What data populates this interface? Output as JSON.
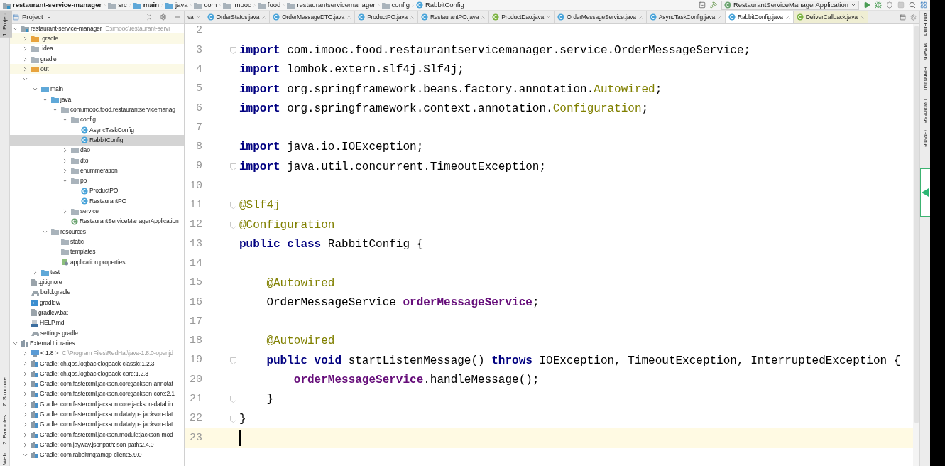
{
  "breadcrumbs": [
    {
      "label": "restaurant-service-manager",
      "kind": "module",
      "bold": true
    },
    {
      "label": "src",
      "kind": "folder",
      "bold": false
    },
    {
      "label": "main",
      "kind": "source",
      "bold": true
    },
    {
      "label": "java",
      "kind": "source",
      "bold": false
    },
    {
      "label": "com",
      "kind": "package",
      "bold": false
    },
    {
      "label": "imooc",
      "kind": "package",
      "bold": false
    },
    {
      "label": "food",
      "kind": "package",
      "bold": false
    },
    {
      "label": "restaurantservicemanager",
      "kind": "package",
      "bold": false
    },
    {
      "label": "config",
      "kind": "package",
      "bold": false
    },
    {
      "label": "RabbitConfig",
      "kind": "class",
      "bold": false
    }
  ],
  "run_configuration": "RestaurantServiceManagerApplication",
  "project_panel": {
    "title": "Project",
    "tree": [
      {
        "label": "restaurant-service-manager",
        "hint": "E:\\imooc\\restaurant-servi",
        "kind": "module",
        "expanded": true,
        "selected": false,
        "children": [
          {
            "label": ".gradle",
            "kind": "excluded",
            "expanded": false,
            "selected": false
          },
          {
            "label": ".idea",
            "kind": "folder",
            "expanded": false,
            "selected": false
          },
          {
            "label": "gradle",
            "kind": "folder",
            "expanded": false,
            "selected": false
          },
          {
            "label": "out",
            "kind": "excluded",
            "expanded": false,
            "selected": false
          },
          {
            "kind": "obscured",
            "expanded": true,
            "selected": false,
            "children": [
              {
                "label": "main",
                "kind": "source",
                "expanded": true,
                "selected": false,
                "children": [
                  {
                    "label": "java",
                    "kind": "source",
                    "expanded": true,
                    "selected": false,
                    "children": [
                      {
                        "label": "com.imooc.food.restaurantservicemanag",
                        "kind": "package",
                        "expanded": true,
                        "selected": false,
                        "children": [
                          {
                            "label": "config",
                            "kind": "package",
                            "expanded": true,
                            "selected": false,
                            "children": [
                              {
                                "label": "AsyncTaskConfig",
                                "kind": "class",
                                "selected": false
                              },
                              {
                                "label": "RabbitConfig",
                                "kind": "class",
                                "selected": true
                              }
                            ]
                          },
                          {
                            "label": "dao",
                            "kind": "package",
                            "expanded": false,
                            "selected": false
                          },
                          {
                            "label": "dto",
                            "kind": "package",
                            "expanded": false,
                            "selected": false
                          },
                          {
                            "label": "enummeration",
                            "kind": "package",
                            "expanded": false,
                            "selected": false
                          },
                          {
                            "label": "po",
                            "kind": "package",
                            "expanded": true,
                            "selected": false,
                            "children": [
                              {
                                "label": "ProductPO",
                                "kind": "class",
                                "selected": false
                              },
                              {
                                "label": "RestaurantPO",
                                "kind": "class",
                                "selected": false
                              }
                            ]
                          },
                          {
                            "label": "service",
                            "kind": "package",
                            "expanded": false,
                            "selected": false
                          },
                          {
                            "label": "RestaurantServiceManagerApplication",
                            "kind": "spring",
                            "selected": false
                          }
                        ]
                      }
                    ]
                  },
                  {
                    "label": "resources",
                    "kind": "resources",
                    "expanded": true,
                    "selected": false,
                    "children": [
                      {
                        "label": "static",
                        "kind": "folder",
                        "selected": false
                      },
                      {
                        "label": "templates",
                        "kind": "folder",
                        "selected": false
                      },
                      {
                        "label": "application.properties",
                        "kind": "properties",
                        "selected": false
                      }
                    ]
                  }
                ]
              },
              {
                "label": "test",
                "kind": "source",
                "expanded": false,
                "selected": false
              }
            ]
          },
          {
            "label": ".gitignore",
            "kind": "file",
            "selected": false
          },
          {
            "label": "build.gradle",
            "kind": "gradle",
            "selected": false
          },
          {
            "label": "gradlew",
            "kind": "script",
            "selected": false
          },
          {
            "label": "gradlew.bat",
            "kind": "file",
            "selected": false
          },
          {
            "label": "HELP.md",
            "kind": "markdown",
            "selected": false
          },
          {
            "label": "settings.gradle",
            "kind": "gradle",
            "selected": false
          }
        ]
      },
      {
        "label": "External Libraries",
        "kind": "libraries",
        "expanded": true,
        "selected": false,
        "children": [
          {
            "label": "< 1.8 >",
            "hint": "C:\\Program Files\\RedHat\\java-1.8.0-openjd",
            "kind": "jdk",
            "expanded": false,
            "selected": false
          },
          {
            "label": "Gradle: ch.qos.logback:logback-classic:1.2.3",
            "kind": "library",
            "expanded": false,
            "selected": false
          },
          {
            "label": "Gradle: ch.qos.logback:logback-core:1.2.3",
            "kind": "library",
            "expanded": false,
            "selected": false
          },
          {
            "label": "Gradle: com.fasterxml.jackson.core:jackson-annotat",
            "kind": "library",
            "expanded": false,
            "selected": false
          },
          {
            "label": "Gradle: com.fasterxml.jackson.core:jackson-core:2.1",
            "kind": "library",
            "expanded": false,
            "selected": false
          },
          {
            "label": "Gradle: com.fasterxml.jackson.core:jackson-databin",
            "kind": "library",
            "expanded": false,
            "selected": false
          },
          {
            "label": "Gradle: com.fasterxml.jackson.datatype:jackson-dat",
            "kind": "library",
            "expanded": false,
            "selected": false
          },
          {
            "label": "Gradle: com.fasterxml.jackson.datatype:jackson-dat",
            "kind": "library",
            "expanded": false,
            "selected": false
          },
          {
            "label": "Gradle: com.fasterxml.jackson.module:jackson-mod",
            "kind": "library",
            "expanded": false,
            "selected": false
          },
          {
            "label": "Gradle: com.jayway.jsonpath:json-path:2.4.0",
            "kind": "library",
            "expanded": false,
            "selected": false
          },
          {
            "label": "Gradle: com.rabbitmq:amqp-client:5.9.0",
            "kind": "library",
            "expanded": true,
            "selected": false
          }
        ]
      }
    ]
  },
  "tabs": [
    {
      "label": "va",
      "library": false,
      "selected": false
    },
    {
      "label": "OrderStatus.java",
      "kind": "class",
      "library": false,
      "selected": false
    },
    {
      "label": "OrderMessageDTO.java",
      "kind": "class",
      "library": false,
      "selected": false
    },
    {
      "label": "ProductPO.java",
      "kind": "class",
      "library": false,
      "selected": false
    },
    {
      "label": "RestaurantPO.java",
      "kind": "class",
      "library": false,
      "selected": false
    },
    {
      "label": "ProductDao.java",
      "kind": "interface",
      "library": false,
      "selected": false
    },
    {
      "label": "OrderMessageService.java",
      "kind": "class",
      "library": false,
      "selected": false
    },
    {
      "label": "AsyncTaskConfig.java",
      "kind": "class",
      "library": false,
      "selected": false
    },
    {
      "label": "RabbitConfig.java",
      "kind": "class",
      "library": false,
      "selected": true
    },
    {
      "label": "DeliverCallback.java",
      "kind": "interface",
      "library": true,
      "selected": false
    }
  ],
  "editor": {
    "lines": [
      {
        "number": "2",
        "fold": false,
        "current": false
      },
      {
        "number": "3",
        "fold": true,
        "current": false,
        "tokens": [
          {
            "text": "import",
            "kind": "keyword"
          },
          {
            "text": " com.imooc.food.restaurantservicemanager.service.OrderMessageService;",
            "kind": "plain"
          }
        ]
      },
      {
        "number": "4",
        "fold": false,
        "current": false,
        "tokens": [
          {
            "text": "import",
            "kind": "keyword"
          },
          {
            "text": " lombok.extern.slf4j.Slf4j;",
            "kind": "plain"
          }
        ]
      },
      {
        "number": "5",
        "fold": false,
        "current": false,
        "tokens": [
          {
            "text": "import",
            "kind": "keyword"
          },
          {
            "text": " org.springframework.beans.factory.annotation.",
            "kind": "plain"
          },
          {
            "text": "Autowired",
            "kind": "annotation"
          },
          {
            "text": ";",
            "kind": "plain"
          }
        ]
      },
      {
        "number": "6",
        "fold": false,
        "current": false,
        "tokens": [
          {
            "text": "import",
            "kind": "keyword"
          },
          {
            "text": " org.springframework.context.annotation.",
            "kind": "plain"
          },
          {
            "text": "Configuration",
            "kind": "annotation"
          },
          {
            "text": ";",
            "kind": "plain"
          }
        ]
      },
      {
        "number": "7",
        "fold": false,
        "current": false
      },
      {
        "number": "8",
        "fold": false,
        "current": false,
        "tokens": [
          {
            "text": "import",
            "kind": "keyword"
          },
          {
            "text": " java.io.IOException;",
            "kind": "plain"
          }
        ]
      },
      {
        "number": "9",
        "fold": true,
        "current": false,
        "tokens": [
          {
            "text": "import",
            "kind": "keyword"
          },
          {
            "text": " java.util.concurrent.TimeoutException;",
            "kind": "plain"
          }
        ]
      },
      {
        "number": "10",
        "fold": false,
        "current": false
      },
      {
        "number": "11",
        "fold": true,
        "current": false,
        "tokens": [
          {
            "text": "@Slf4j",
            "kind": "annotation"
          }
        ]
      },
      {
        "number": "12",
        "fold": true,
        "current": false,
        "tokens": [
          {
            "text": "@Configuration",
            "kind": "annotation"
          }
        ]
      },
      {
        "number": "13",
        "fold": false,
        "current": false,
        "tokens": [
          {
            "text": "public class",
            "kind": "keyword"
          },
          {
            "text": " RabbitConfig {",
            "kind": "plain"
          }
        ]
      },
      {
        "number": "14",
        "fold": false,
        "current": false
      },
      {
        "number": "15",
        "fold": false,
        "current": false,
        "tokens": [
          {
            "text": "    @Autowired",
            "kind": "annotation"
          }
        ]
      },
      {
        "number": "16",
        "fold": false,
        "current": false,
        "tokens": [
          {
            "text": "    OrderMessageService ",
            "kind": "plain"
          },
          {
            "text": "orderMessageService",
            "kind": "field"
          },
          {
            "text": ";",
            "kind": "plain"
          }
        ]
      },
      {
        "number": "17",
        "fold": false,
        "current": false
      },
      {
        "number": "18",
        "fold": false,
        "current": false,
        "tokens": [
          {
            "text": "    @Autowired",
            "kind": "annotation"
          }
        ]
      },
      {
        "number": "19",
        "fold": true,
        "current": false,
        "tokens": [
          {
            "text": "    public void",
            "kind": "keyword"
          },
          {
            "text": " startListenMessage() ",
            "kind": "plain"
          },
          {
            "text": "throws",
            "kind": "keyword"
          },
          {
            "text": " IOException, TimeoutException, InterruptedException {",
            "kind": "plain"
          }
        ]
      },
      {
        "number": "20",
        "fold": false,
        "current": false,
        "tokens": [
          {
            "text": "        orderMessageService",
            "kind": "field"
          },
          {
            "text": ".handleMessage();",
            "kind": "plain"
          }
        ]
      },
      {
        "number": "21",
        "fold": true,
        "current": false,
        "tokens": [
          {
            "text": "    }",
            "kind": "plain"
          }
        ]
      },
      {
        "number": "22",
        "fold": true,
        "current": false,
        "tokens": [
          {
            "text": "}",
            "kind": "plain"
          }
        ]
      },
      {
        "number": "23",
        "fold": false,
        "current": true
      }
    ]
  },
  "left_tool_strip": {
    "top": [
      {
        "label": "1: Project",
        "selected": true
      }
    ],
    "bottom": [
      {
        "label": "7: Structure",
        "selected": false
      },
      {
        "label": "2: Favorites",
        "selected": false
      },
      {
        "label": "Web",
        "selected": false
      }
    ]
  },
  "right_tool_strip": [
    {
      "label": "Ant Build"
    },
    {
      "label": "Maven"
    },
    {
      "label": "PlantUML"
    },
    {
      "label": "Database"
    },
    {
      "label": "Gradle"
    }
  ]
}
